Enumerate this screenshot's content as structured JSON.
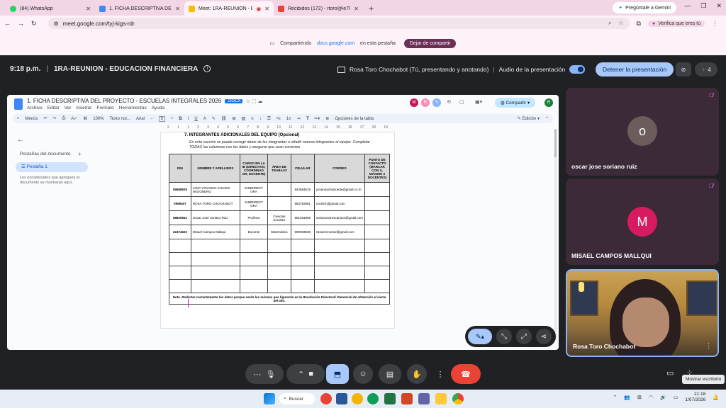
{
  "browser": {
    "tabs": [
      {
        "title": "(84) WhatsApp",
        "color": "#25d366"
      },
      {
        "title": "1. FICHA DESCRIPTIVA DEL",
        "color": "#4285f4"
      },
      {
        "title": "Meet: 1RA-REUNION - EDU",
        "color": "#fbbc04"
      },
      {
        "title": "Recibidos (172) - rtoro@ie707",
        "color": "#ea4335"
      }
    ],
    "new_tab": "+",
    "gemini": "Pregúntale a Gemini",
    "url": "meet.google.com/tyj-kigs-rdr",
    "verify": "Verifica que eres tú"
  },
  "share_banner": {
    "text": "Compartiendo",
    "domain": "docs.google.com",
    "suffix": "en esta pestaña",
    "stop": "Dejar de compartir"
  },
  "meet": {
    "time": "9:18 p.m.",
    "separator": "|",
    "title": "1RA-REUNION - EDUCACION FINANCIERA",
    "presenter": "Rosa Toro Chochabot (Tú, presentando y anotando)",
    "audio": "Audio de la presentación",
    "stop_presenting": "Detener la presentación",
    "participants_count": "4"
  },
  "doc": {
    "title": "1. FICHA DESCRIPTIVA DEL PROYECTO - ESCUELAS INTEGRALES 2026",
    "badge": ".DOCX",
    "menu": [
      "Archivo",
      "Editar",
      "Ver",
      "Insertar",
      "Formato",
      "Herramientas",
      "Ayuda"
    ],
    "share": "Compartir",
    "toolbar": {
      "menus": "Menús",
      "zoom": "100%",
      "style": "Texto nor...",
      "font": "Arial",
      "size": "9",
      "table_options": "Opciones de la tabla",
      "mode": "Edición"
    },
    "ruler": [
      "2",
      "1",
      "1",
      "2",
      "3",
      "4",
      "5",
      "6",
      "7",
      "8",
      "9",
      "10",
      "11",
      "12",
      "13",
      "14",
      "15",
      "16",
      "17",
      "18",
      "19"
    ],
    "outline": {
      "title": "Pestañas del documento",
      "tab": "Pestaña 1",
      "note": "Los encabezados que agregues al documento se mostrarán aquí."
    },
    "section_title": "7.  INTEGRANTES ADICIONALES DEL EQUIPO (Opcional)",
    "section_desc": "En esta sección se puede corregir datos de los integrantes o añadir nuevos integrantes al equipo. Completar TODAS las columnas con los datos y asegurar que sean correctos",
    "table": {
      "headers": [
        "DNI",
        "NOMBRE Y APELLIDOS",
        "CARGO EN LA IE (DIRECTIVO, COORDINAD OR, DOCENTE)",
        "ÁREA DE TRABAJO",
        "CELULAR",
        "CORREO",
        "PUNTO DE CONTACTO (MARCAR CON X, MÁXIMO 2 DOCENTES)"
      ],
      "rows": [
        [
          "09688929",
          "LIDIA YOVANNA CHUISO MOJONERO",
          "SUBDIRECT ORA",
          "",
          "942684619",
          "yovannachuisoedu@gmail.co m",
          ""
        ],
        [
          "0959407",
          "ROSA TORO CHOCHABOT",
          "SUBDIRECT ORA",
          "",
          "983792681",
          "rocahch@gmail.com",
          ""
        ],
        [
          "08830551",
          "Oscar José Soriano Ruiz",
          "Profesor",
          "Ciencias Sociales",
          "961381809",
          "sorianoruizoscarjose@gmail.com",
          ""
        ],
        [
          "22474623",
          "Misael Campos Mallqui",
          "Docente",
          "Matemática",
          "990093836",
          "misaelcm1612@gmail.com",
          ""
        ]
      ],
      "note": "Nota. Redactar correctamente los datos porque serán los mismos que figurarán en la Resolución Directoral /Gerencial de obtención al cierre del año."
    }
  },
  "participants": [
    {
      "name": "oscar jose soriano ruiz",
      "initial": "o",
      "color": "#6d5c5c"
    },
    {
      "name": "MISAEL CAMPOS MALLQUI",
      "initial": "M",
      "color": "#d81b60"
    },
    {
      "name": "Rosa Toro Chochabot",
      "initial": "",
      "color": ""
    }
  ],
  "controls": {
    "tooltip": "Mostrar escritorio"
  },
  "taskbar": {
    "search": "Buscar",
    "time": "21:18",
    "date": "1/07/2026"
  }
}
